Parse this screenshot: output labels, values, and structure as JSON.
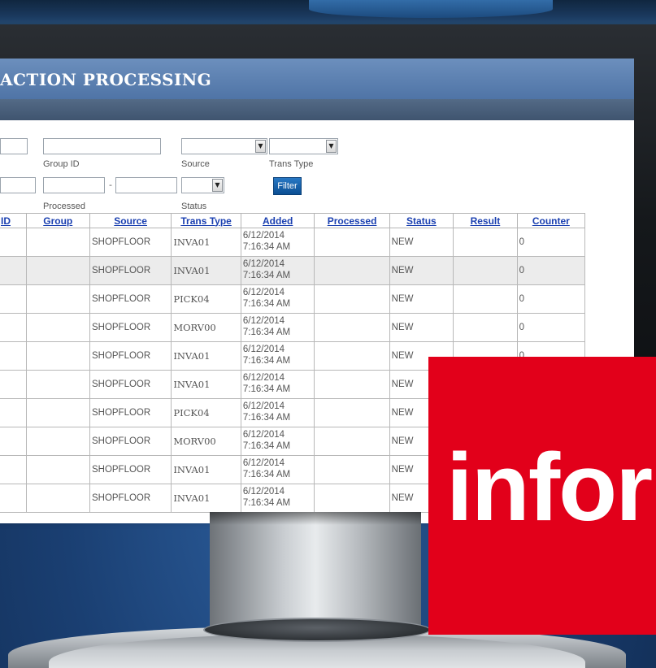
{
  "app": {
    "title": "ACTION PROCESSING"
  },
  "filters": {
    "group_id_label": "Group ID",
    "source_label": "Source",
    "trans_type_label": "Trans Type",
    "processed_label": "Processed",
    "status_label": "Status",
    "range_separator": "-",
    "filter_button": "Filter"
  },
  "table": {
    "columns": [
      "ID",
      "Group",
      "Source",
      "Trans Type",
      "Added",
      "Processed",
      "Status",
      "Result",
      "Counter"
    ],
    "rows": [
      {
        "source": "SHOPFLOOR",
        "trans_type": "INVA01",
        "added_date": "6/12/2014",
        "added_time": "7:16:34 AM",
        "processed": "",
        "status": "NEW",
        "result": "",
        "counter": "0"
      },
      {
        "source": "SHOPFLOOR",
        "trans_type": "INVA01",
        "added_date": "6/12/2014",
        "added_time": "7:16:34 AM",
        "processed": "",
        "status": "NEW",
        "result": "",
        "counter": "0"
      },
      {
        "source": "SHOPFLOOR",
        "trans_type": "PICK04",
        "added_date": "6/12/2014",
        "added_time": "7:16:34 AM",
        "processed": "",
        "status": "NEW",
        "result": "",
        "counter": "0"
      },
      {
        "source": "SHOPFLOOR",
        "trans_type": "MORV00",
        "added_date": "6/12/2014",
        "added_time": "7:16:34 AM",
        "processed": "",
        "status": "NEW",
        "result": "",
        "counter": "0"
      },
      {
        "source": "SHOPFLOOR",
        "trans_type": "INVA01",
        "added_date": "6/12/2014",
        "added_time": "7:16:34 AM",
        "processed": "",
        "status": "NEW",
        "result": "",
        "counter": "0"
      },
      {
        "source": "SHOPFLOOR",
        "trans_type": "INVA01",
        "added_date": "6/12/2014",
        "added_time": "7:16:34 AM",
        "processed": "",
        "status": "NEW",
        "result": "",
        "counter": ""
      },
      {
        "source": "SHOPFLOOR",
        "trans_type": "PICK04",
        "added_date": "6/12/2014",
        "added_time": "7:16:34 AM",
        "processed": "",
        "status": "NEW",
        "result": "",
        "counter": ""
      },
      {
        "source": "SHOPFLOOR",
        "trans_type": "MORV00",
        "added_date": "6/12/2014",
        "added_time": "7:16:34 AM",
        "processed": "",
        "status": "NEW",
        "result": "",
        "counter": ""
      },
      {
        "source": "SHOPFLOOR",
        "trans_type": "INVA01",
        "added_date": "6/12/2014",
        "added_time": "7:16:34 AM",
        "processed": "",
        "status": "NEW",
        "result": "",
        "counter": ""
      },
      {
        "source": "SHOPFLOOR",
        "trans_type": "INVA01",
        "added_date": "6/12/2014",
        "added_time": "7:16:34 AM",
        "processed": "",
        "status": "NEW",
        "result": "",
        "counter": ""
      }
    ]
  },
  "logo": {
    "text": "infor",
    "color": "#e2001a"
  }
}
